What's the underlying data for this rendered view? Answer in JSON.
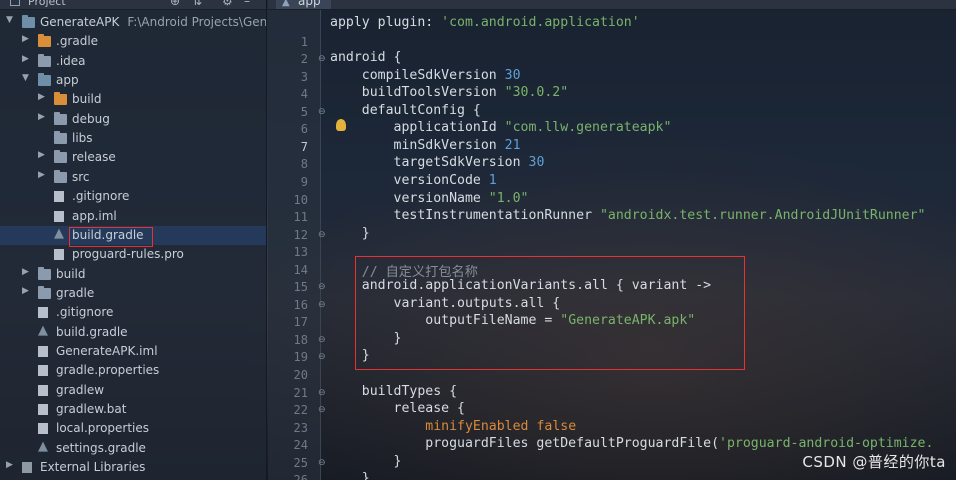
{
  "project_panel": {
    "title": "Project",
    "tree": [
      {
        "label": "GenerateAPK",
        "path": "F:\\Android Projects\\Generat",
        "depth": 0,
        "arrow": "▼",
        "icon": "module"
      },
      {
        "label": ".gradle",
        "depth": 1,
        "arrow": "▶",
        "icon": "folder-orange"
      },
      {
        "label": ".idea",
        "depth": 1,
        "arrow": "▶",
        "icon": "folder"
      },
      {
        "label": "app",
        "depth": 1,
        "arrow": "▼",
        "icon": "module"
      },
      {
        "label": "build",
        "depth": 2,
        "arrow": "▶",
        "icon": "folder-orange"
      },
      {
        "label": "debug",
        "depth": 2,
        "arrow": "▶",
        "icon": "folder"
      },
      {
        "label": "libs",
        "depth": 2,
        "arrow": "",
        "icon": "folder"
      },
      {
        "label": "release",
        "depth": 2,
        "arrow": "▶",
        "icon": "folder"
      },
      {
        "label": "src",
        "depth": 2,
        "arrow": "▶",
        "icon": "folder"
      },
      {
        "label": ".gitignore",
        "depth": 2,
        "arrow": "",
        "icon": "file"
      },
      {
        "label": "app.iml",
        "depth": 2,
        "arrow": "",
        "icon": "file"
      },
      {
        "label": "build.gradle",
        "depth": 2,
        "arrow": "",
        "icon": "gradle",
        "selected": true
      },
      {
        "label": "proguard-rules.pro",
        "depth": 2,
        "arrow": "",
        "icon": "file"
      },
      {
        "label": "build",
        "depth": 1,
        "arrow": "▶",
        "icon": "folder"
      },
      {
        "label": "gradle",
        "depth": 1,
        "arrow": "▶",
        "icon": "folder"
      },
      {
        "label": ".gitignore",
        "depth": 1,
        "arrow": "",
        "icon": "file"
      },
      {
        "label": "build.gradle",
        "depth": 1,
        "arrow": "",
        "icon": "gradle"
      },
      {
        "label": "GenerateAPK.iml",
        "depth": 1,
        "arrow": "",
        "icon": "file"
      },
      {
        "label": "gradle.properties",
        "depth": 1,
        "arrow": "",
        "icon": "file"
      },
      {
        "label": "gradlew",
        "depth": 1,
        "arrow": "",
        "icon": "file"
      },
      {
        "label": "gradlew.bat",
        "depth": 1,
        "arrow": "",
        "icon": "file"
      },
      {
        "label": "local.properties",
        "depth": 1,
        "arrow": "",
        "icon": "file"
      },
      {
        "label": "settings.gradle",
        "depth": 1,
        "arrow": "",
        "icon": "gradle"
      },
      {
        "label": "External Libraries",
        "depth": 0,
        "arrow": "▶",
        "icon": "library"
      }
    ]
  },
  "editor": {
    "tab_label": "app",
    "active_line": "7",
    "lines": [
      {
        "num": "",
        "parts": [
          [
            "apply plugin: ",
            "kw"
          ],
          [
            "'com.android.application'",
            "str"
          ]
        ]
      },
      {
        "num": "1",
        "parts": []
      },
      {
        "num": "2",
        "parts": [
          [
            "android {",
            "kw"
          ]
        ],
        "fold": true
      },
      {
        "num": "3",
        "parts": [
          [
            "    compileSdkVersion ",
            "kw"
          ],
          [
            "30",
            "num"
          ]
        ]
      },
      {
        "num": "4",
        "parts": [
          [
            "    buildToolsVersion ",
            "kw"
          ],
          [
            "\"30.0.2\"",
            "str"
          ]
        ]
      },
      {
        "num": "5",
        "parts": [
          [
            "    defaultConfig {",
            "kw"
          ]
        ],
        "fold": true
      },
      {
        "num": "6",
        "parts": [
          [
            "        applicationId ",
            "kw"
          ],
          [
            "\"com.llw.generateapk\"",
            "str"
          ]
        ]
      },
      {
        "num": "7",
        "parts": [
          [
            "        minSdkVersion ",
            "kw"
          ],
          [
            "21",
            "num"
          ]
        ]
      },
      {
        "num": "8",
        "parts": [
          [
            "        targetSdkVersion ",
            "kw"
          ],
          [
            "30",
            "num"
          ]
        ]
      },
      {
        "num": "9",
        "parts": [
          [
            "        versionCode ",
            "kw"
          ],
          [
            "1",
            "num"
          ]
        ]
      },
      {
        "num": "10",
        "parts": [
          [
            "        versionName ",
            "kw"
          ],
          [
            "\"1.0\"",
            "str"
          ]
        ]
      },
      {
        "num": "11",
        "parts": [
          [
            "        testInstrumentationRunner ",
            "kw"
          ],
          [
            "\"androidx.test.runner.AndroidJUnitRunner\"",
            "str"
          ]
        ]
      },
      {
        "num": "12",
        "parts": [
          [
            "    }",
            "kw"
          ]
        ],
        "fold": true
      },
      {
        "num": "13",
        "parts": []
      },
      {
        "num": "14",
        "parts": [
          [
            "    // 自定义打包名称",
            "cm"
          ]
        ]
      },
      {
        "num": "15",
        "parts": [
          [
            "    android.applicationVariants.all { variant ->",
            "kw"
          ]
        ],
        "fold": true
      },
      {
        "num": "16",
        "parts": [
          [
            "        variant.outputs.all {",
            "kw"
          ]
        ],
        "fold": true
      },
      {
        "num": "17",
        "parts": [
          [
            "            outputFileName = ",
            "kw"
          ],
          [
            "\"GenerateAPK.apk\"",
            "str"
          ]
        ]
      },
      {
        "num": "18",
        "parts": [
          [
            "        }",
            "kw"
          ]
        ],
        "fold": true
      },
      {
        "num": "19",
        "parts": [
          [
            "    }",
            "kw"
          ]
        ],
        "fold": true
      },
      {
        "num": "20",
        "parts": []
      },
      {
        "num": "21",
        "parts": [
          [
            "    buildTypes {",
            "kw"
          ]
        ],
        "fold": true
      },
      {
        "num": "22",
        "parts": [
          [
            "        release {",
            "kw"
          ]
        ],
        "fold": true
      },
      {
        "num": "23",
        "parts": [
          [
            "            minifyEnabled ",
            "orange"
          ],
          [
            "false",
            "orange"
          ]
        ]
      },
      {
        "num": "24",
        "parts": [
          [
            "            proguardFiles getDefaultProguardFile(",
            "kw"
          ],
          [
            "'proguard-android-optimize.",
            "str"
          ]
        ]
      },
      {
        "num": "25",
        "parts": [
          [
            "        }",
            "kw"
          ]
        ],
        "fold": true
      },
      {
        "num": "26",
        "parts": [
          [
            "    }",
            "kw"
          ]
        ]
      }
    ]
  },
  "watermark": "CSDN @普经的你ta"
}
